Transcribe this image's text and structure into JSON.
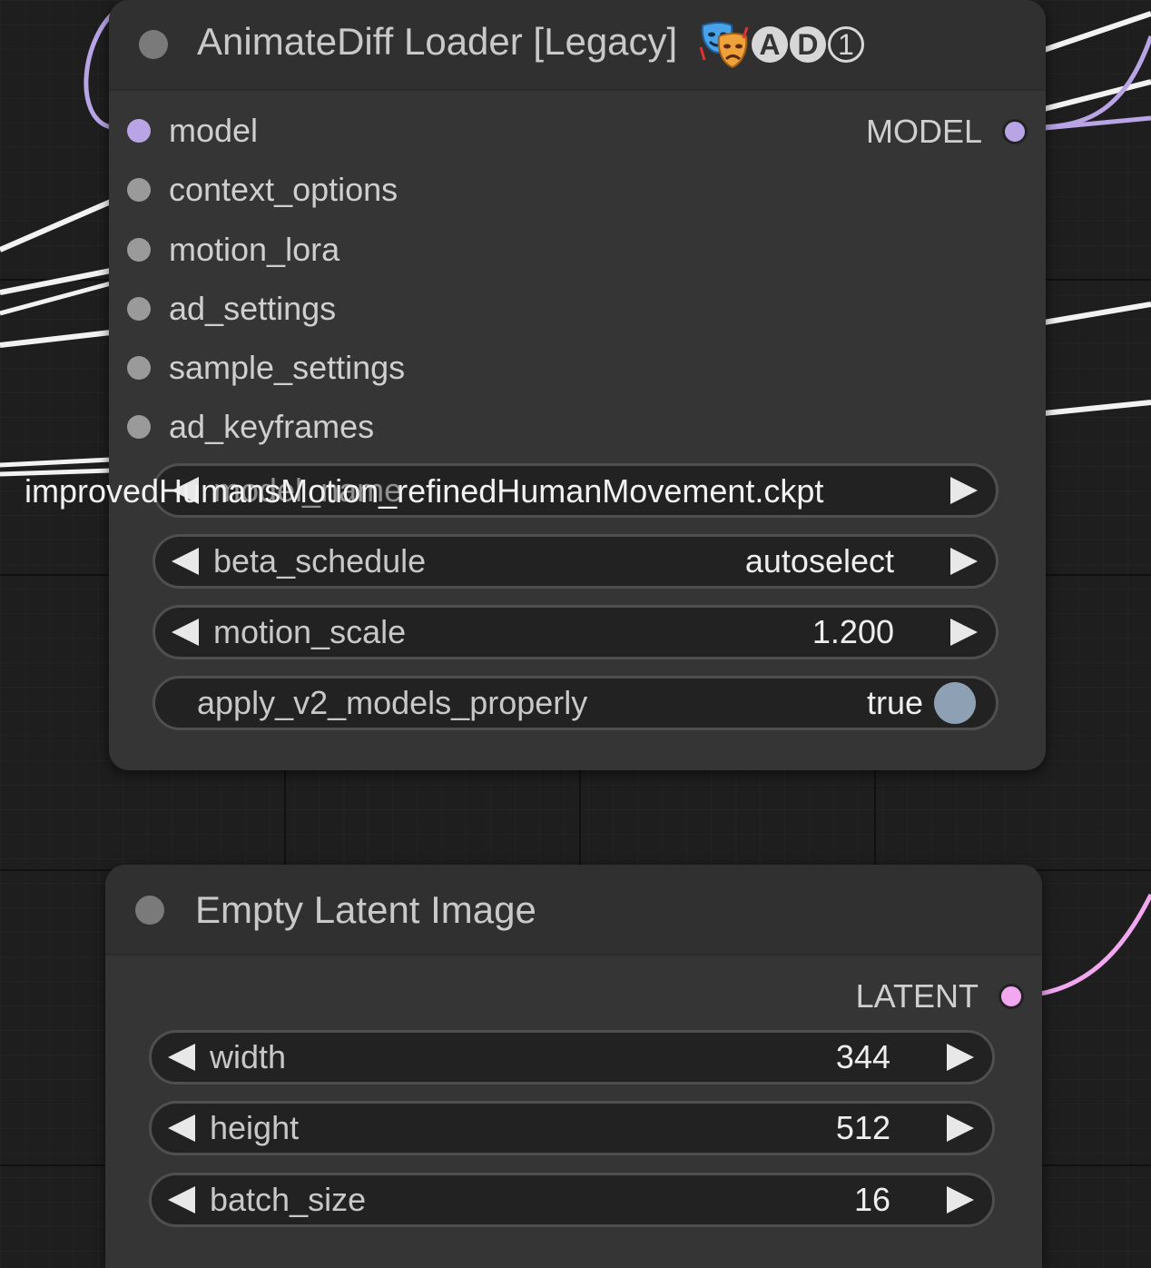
{
  "colors": {
    "model_link": "#b9a4e6",
    "latent_link": "#f1a8f0",
    "generic_link": "#f2f2f2"
  },
  "animatediff_node": {
    "title": "AnimateDiff Loader [Legacy]",
    "badge_icon": "comedy-tragedy-masks-icon",
    "badge_letters": [
      "A",
      "D"
    ],
    "badge_number": "1",
    "inputs": [
      "model",
      "context_options",
      "motion_lora",
      "ad_settings",
      "sample_settings",
      "ad_keyframes"
    ],
    "output_label": "MODEL",
    "model_name_label": "model_name",
    "model_name_value": "improvedHumansMotion_refinedHumanMovement.ckpt",
    "widgets": {
      "beta_schedule": {
        "label": "beta_schedule",
        "value": "autoselect"
      },
      "motion_scale": {
        "label": "motion_scale",
        "value": "1.200"
      },
      "apply_v2": {
        "label": "apply_v2_models_properly",
        "value": "true"
      }
    }
  },
  "latent_node": {
    "title": "Empty Latent Image",
    "output_label": "LATENT",
    "widgets": {
      "width": {
        "label": "width",
        "value": "344"
      },
      "height": {
        "label": "height",
        "value": "512"
      },
      "batch_size": {
        "label": "batch_size",
        "value": "16"
      }
    }
  }
}
